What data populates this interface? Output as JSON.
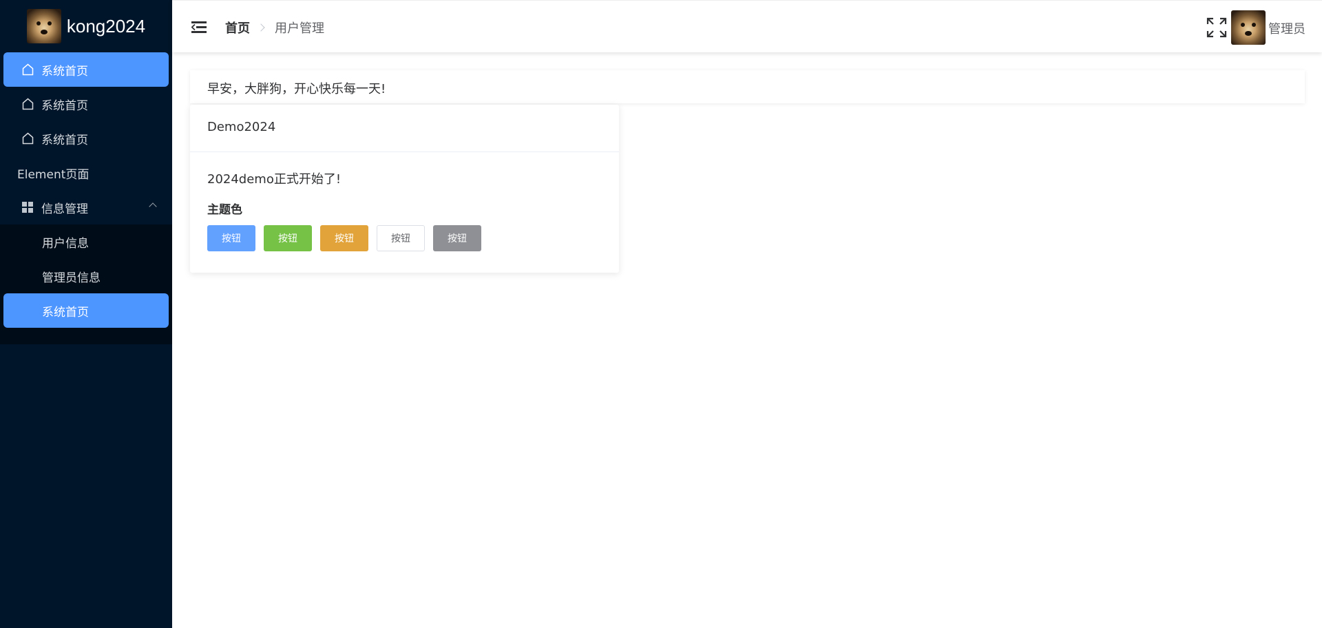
{
  "app": {
    "logo_text": "kong2024"
  },
  "sidebar": {
    "items": [
      {
        "label": "系统首页",
        "active": true,
        "icon": "home-icon"
      },
      {
        "label": "系统首页",
        "active": false,
        "icon": "home-icon"
      },
      {
        "label": "系统首页",
        "active": false,
        "icon": "home-icon"
      },
      {
        "label": "Element页面",
        "active": false
      }
    ],
    "group": {
      "label": "信息管理",
      "icon": "grid-icon",
      "expanded": true,
      "children": [
        {
          "label": "用户信息",
          "active": false
        },
        {
          "label": "管理员信息",
          "active": false
        },
        {
          "label": "系统首页",
          "active": true
        }
      ]
    }
  },
  "header": {
    "breadcrumb": {
      "home": "首页",
      "current": "用户管理"
    },
    "user_name": "管理员"
  },
  "main": {
    "welcome": "早安，大胖狗，开心快乐每一天!",
    "card": {
      "title": "Demo2024",
      "text": "2024demo正式开始了!",
      "subtitle": "主题色",
      "buttons": [
        "按钮",
        "按钮",
        "按钮",
        "按钮",
        "按钮"
      ]
    }
  },
  "colors": {
    "sidebar_bg": "#001529",
    "active": "#4d95ff",
    "primary": "#63a1ff",
    "success": "#75c247",
    "warning": "#e2a43a",
    "info": "#8e9095"
  }
}
